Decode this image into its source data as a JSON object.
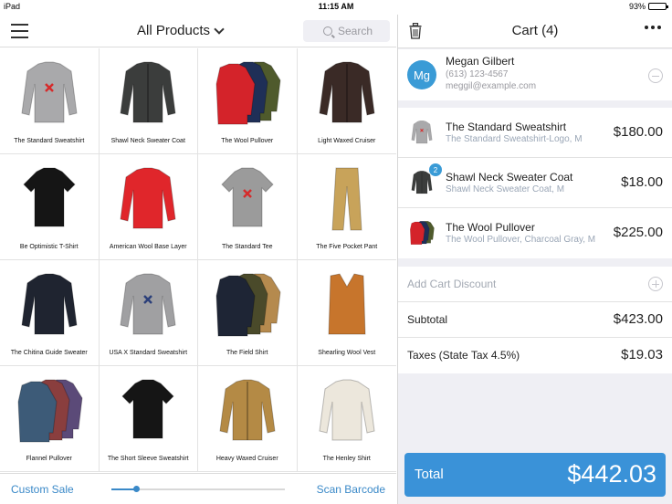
{
  "status": {
    "device": "iPad",
    "time": "11:15 AM",
    "battery": "93%",
    "battery_level": 0.93
  },
  "left": {
    "title": "All Products",
    "search_placeholder": "Search",
    "products": [
      {
        "name": "The Standard Sweatshirt",
        "color": "#a9a9ab",
        "kind": "sweatshirt",
        "mark": "#d62b2b"
      },
      {
        "name": "Shawl Neck Sweater Coat",
        "color": "#3b3d3c",
        "kind": "coat"
      },
      {
        "name": "The Wool Pullover",
        "color": "#d4232a",
        "kind": "group",
        "colors": [
          "#d4232a",
          "#1f2f57",
          "#4f5a2c"
        ]
      },
      {
        "name": "Light Waxed Cruiser",
        "color": "#3a2a26",
        "kind": "coat"
      },
      {
        "name": "Be Optimistic T-Shirt",
        "color": "#151515",
        "kind": "tee"
      },
      {
        "name": "American Wool Base Layer",
        "color": "#e0262b",
        "kind": "longsleeve"
      },
      {
        "name": "The Standard Tee",
        "color": "#9b9b9b",
        "kind": "tee",
        "mark": "#d62b2b"
      },
      {
        "name": "The Five Pocket Pant",
        "color": "#c8a35a",
        "kind": "pants"
      },
      {
        "name": "The Chitina Guide Sweater",
        "color": "#1f2430",
        "kind": "sweatshirt"
      },
      {
        "name": "USA X Standard Sweatshirt",
        "color": "#a0a0a2",
        "kind": "sweatshirt",
        "mark": "#2b3f7a"
      },
      {
        "name": "The Field Shirt",
        "color": "#2d3a24",
        "kind": "group",
        "colors": [
          "#1e2535",
          "#4a4a2a",
          "#b58a4e"
        ]
      },
      {
        "name": "Shearling Wool Vest",
        "color": "#c7752c",
        "kind": "vest"
      },
      {
        "name": "Flannel Pullover",
        "color": "#3d5b78",
        "kind": "group",
        "colors": [
          "#3d5b78",
          "#8a3e3e",
          "#5b4a78"
        ]
      },
      {
        "name": "The Short Sleeve Sweatshirt",
        "color": "#151515",
        "kind": "tee"
      },
      {
        "name": "Heavy Waxed Cruiser",
        "color": "#b48a45",
        "kind": "coat"
      },
      {
        "name": "The Henley Shirt",
        "color": "#ece7dc",
        "kind": "longsleeve"
      }
    ],
    "footer": {
      "custom_sale": "Custom Sale",
      "scan_barcode": "Scan Barcode",
      "slider_level": 0.14
    }
  },
  "cart": {
    "title": "Cart (4)",
    "customer": {
      "initials": "Mg",
      "name": "Megan Gilbert",
      "phone": "(613) 123-4567",
      "email": "meggil@example.com"
    },
    "items": [
      {
        "name": "The Standard Sweatshirt",
        "subtitle": "The Standard Sweatshirt-Logo, M",
        "price": "$180.00",
        "qty": "",
        "color": "#a9a9ab",
        "kind": "sweatshirt"
      },
      {
        "name": "Shawl Neck Sweater Coat",
        "subtitle": "Shawl Neck Sweater Coat, M",
        "price": "$18.00",
        "qty": "2",
        "color": "#3b3d3c",
        "kind": "coat"
      },
      {
        "name": "The Wool Pullover",
        "subtitle": "The Wool Pullover, Charcoal Gray, M",
        "price": "$225.00",
        "qty": "",
        "color": "#d4232a",
        "kind": "group"
      }
    ],
    "discount_label": "Add Cart Discount",
    "subtotal_label": "Subtotal",
    "subtotal": "$423.00",
    "taxes_label": "Taxes (State Tax 4.5%)",
    "taxes": "$19.03",
    "total_label": "Total",
    "total": "$442.03"
  },
  "colors": {
    "accent": "#3a92d8",
    "avatar": "#3a9bd6",
    "link": "#3a89c8"
  }
}
